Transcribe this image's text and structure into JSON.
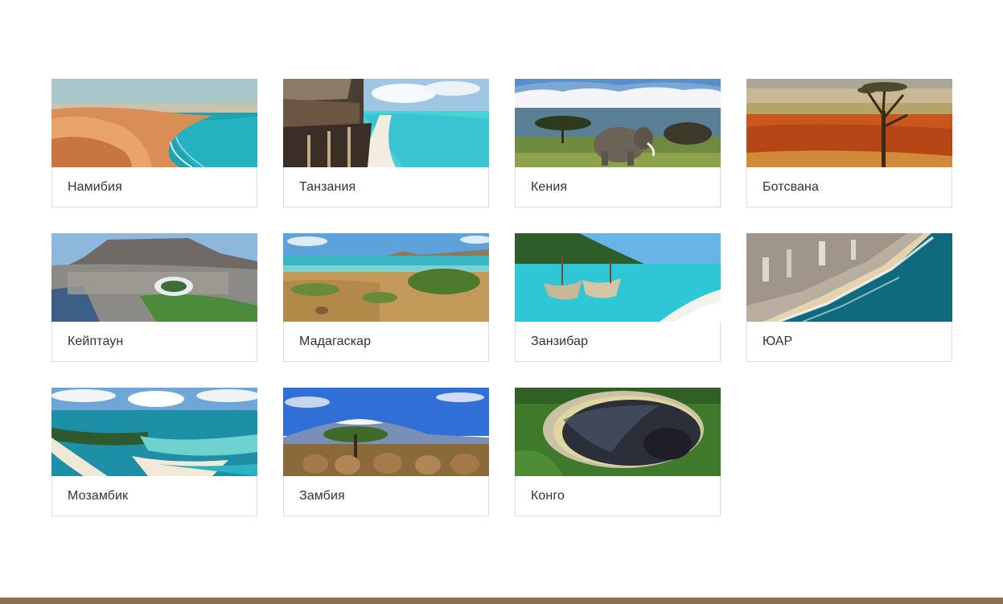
{
  "destinations": [
    {
      "label": "Намибия",
      "scene": "namibia-dunes-image"
    },
    {
      "label": "Танзания",
      "scene": "tanzania-beach-image"
    },
    {
      "label": "Кения",
      "scene": "kenya-elephant-image"
    },
    {
      "label": "Ботсвана",
      "scene": "botswana-desert-tree-image"
    },
    {
      "label": "Кейптаун",
      "scene": "cape-town-stadium-image"
    },
    {
      "label": "Мадагаскар",
      "scene": "madagascar-coast-image"
    },
    {
      "label": "Занзибар",
      "scene": "zanzibar-boats-image"
    },
    {
      "label": "ЮАР",
      "scene": "south-africa-city-coast-image"
    },
    {
      "label": "Мозамбик",
      "scene": "mozambique-lagoon-image"
    },
    {
      "label": "Замбия",
      "scene": "zambia-kilimanjaro-elephants-image"
    },
    {
      "label": "Конго",
      "scene": "congo-crater-lake-image"
    }
  ],
  "colors": {
    "footer_bar": "#8b7150",
    "card_border": "#dcdcdc",
    "caption_text": "#333333"
  }
}
